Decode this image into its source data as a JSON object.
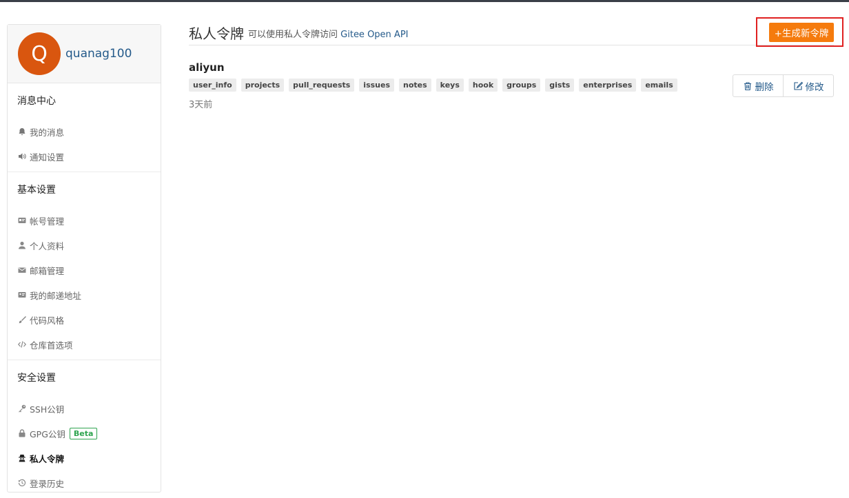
{
  "profile": {
    "avatar_letter": "Q",
    "username": "quanag100"
  },
  "sidebar": {
    "groups": [
      {
        "title": "消息中心",
        "items": [
          {
            "label": "我的消息",
            "icon": "bell-icon"
          },
          {
            "label": "通知设置",
            "icon": "volume-icon"
          }
        ]
      },
      {
        "title": "基本设置",
        "items": [
          {
            "label": "帐号管理",
            "icon": "id-card-icon"
          },
          {
            "label": "个人资料",
            "icon": "user-icon"
          },
          {
            "label": "邮箱管理",
            "icon": "envelope-icon"
          },
          {
            "label": "我的邮递地址",
            "icon": "address-card-icon"
          },
          {
            "label": "代码风格",
            "icon": "paint-brush-icon"
          },
          {
            "label": "仓库首选项",
            "icon": "code-icon"
          }
        ]
      },
      {
        "title": "安全设置",
        "items": [
          {
            "label": "SSH公钥",
            "icon": "key-icon"
          },
          {
            "label": "GPG公钥",
            "icon": "lock-icon",
            "badge": "Beta"
          },
          {
            "label": "私人令牌",
            "icon": "user-secret-icon",
            "active": true
          },
          {
            "label": "登录历史",
            "icon": "history-icon"
          }
        ]
      }
    ]
  },
  "header": {
    "title": "私人令牌",
    "subtitle": "可以使用私人令牌访问",
    "subtitle_link": "Gitee Open API",
    "generate_button": "+生成新令牌"
  },
  "token": {
    "name": "aliyun",
    "scopes": [
      "user_info",
      "projects",
      "pull_requests",
      "issues",
      "notes",
      "keys",
      "hook",
      "groups",
      "gists",
      "enterprises",
      "emails"
    ],
    "time": "3天前",
    "delete_label": "删除",
    "edit_label": "修改"
  },
  "colors": {
    "accent": "#f57b0d",
    "link": "#245a8a",
    "avatar_bg": "#d9560f",
    "highlight": "#e02020",
    "beta": "#2ea44f"
  }
}
